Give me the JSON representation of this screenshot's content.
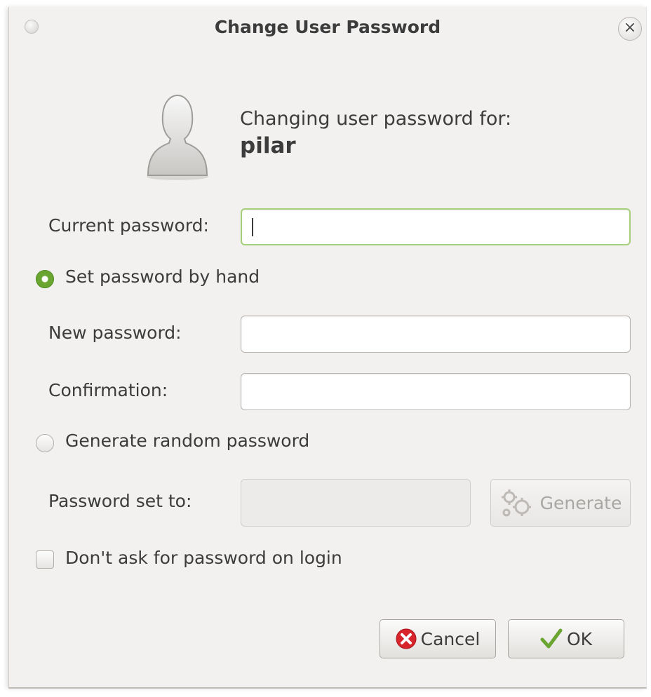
{
  "window": {
    "title": "Change User Password"
  },
  "header": {
    "line1": "Changing user password for:",
    "username": "pilar"
  },
  "form": {
    "current_password_label": "Current password:",
    "current_password_value": "",
    "set_by_hand_label": "Set password by hand",
    "set_by_hand_selected": true,
    "new_password_label": "New password:",
    "new_password_value": "",
    "confirmation_label": "Confirmation:",
    "confirmation_value": "",
    "generate_random_label": "Generate random password",
    "generate_random_selected": false,
    "password_set_to_label": "Password set to:",
    "password_set_to_value": "",
    "generate_button_label": "Generate",
    "dont_ask_label": "Don't ask for password on login",
    "dont_ask_checked": false
  },
  "buttons": {
    "cancel_label": "Cancel",
    "ok_label": "OK"
  },
  "icons": {
    "close": "close-icon",
    "avatar": "user-avatar-icon",
    "generate": "gears-icon",
    "cancel": "cancel-icon",
    "ok": "checkmark-icon"
  },
  "colors": {
    "dialog_bg": "#f2f1f0",
    "focus_ring": "#a6cf7c",
    "radio_active": "#6aa431",
    "cancel_red": "#d8252c",
    "ok_green": "#6aa431"
  }
}
